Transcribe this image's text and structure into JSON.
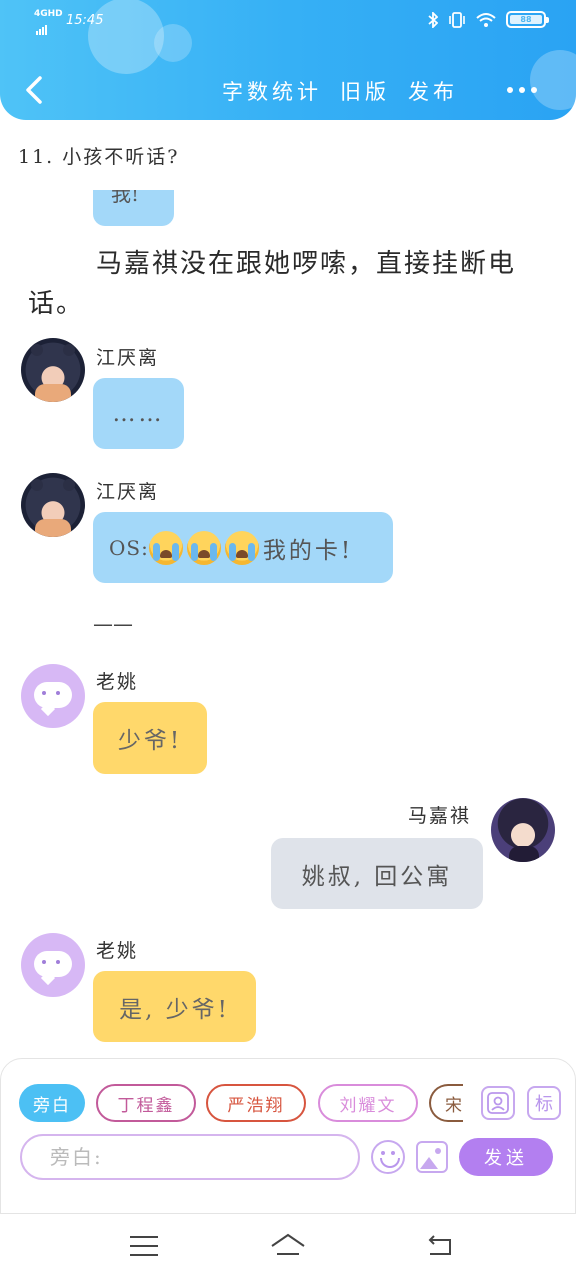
{
  "status_bar": {
    "network": "4GHD",
    "time": "15:45",
    "battery": "88"
  },
  "header": {
    "back_icon": "chevron-left-icon",
    "actions": [
      "字数统计",
      "旧版",
      "发布"
    ],
    "more_icon": "more-dots-icon"
  },
  "chapter": {
    "title": "11. 小孩不听话?",
    "partial_bubble_text": "我!",
    "narration": "马嘉祺没在跟她啰嗦，直接挂断电话。"
  },
  "messages": [
    {
      "sender": "江厌离",
      "text": "……",
      "side": "left",
      "style": "blue",
      "avatar": "girl-avatar"
    },
    {
      "sender": "江厌离",
      "prefix": "OS:",
      "emoji_count": 3,
      "emoji": "loudly-crying-face",
      "text": "我的卡!",
      "side": "left",
      "style": "blue",
      "avatar": "girl-avatar"
    },
    {
      "divider": "——"
    },
    {
      "sender": "老姚",
      "text": "少爷!",
      "side": "left",
      "style": "yellow",
      "avatar": "bot-avatar"
    },
    {
      "sender": "马嘉祺",
      "text": "姚叔, 回公寓",
      "side": "right",
      "style": "gray",
      "avatar": "boy-avatar"
    },
    {
      "sender": "老姚",
      "text": "是, 少爷!",
      "side": "left",
      "style": "yellow",
      "avatar": "bot-avatar"
    }
  ],
  "input": {
    "roles": [
      "旁白",
      "丁程鑫",
      "严浩翔",
      "刘耀文",
      "宋"
    ],
    "active_role": "旁白",
    "contact_icon": "contact-card-icon",
    "tag_label": "标",
    "placeholder": "旁白:",
    "emoji_icon": "smile-icon",
    "image_icon": "image-icon",
    "send_label": "发送"
  },
  "colors": {
    "header_blue": "#36b0f5",
    "bubble_blue": "#a3d8f9",
    "bubble_yellow": "#ffd86b",
    "bubble_gray": "#dfe3ea",
    "accent_purple": "#b37ff0"
  }
}
